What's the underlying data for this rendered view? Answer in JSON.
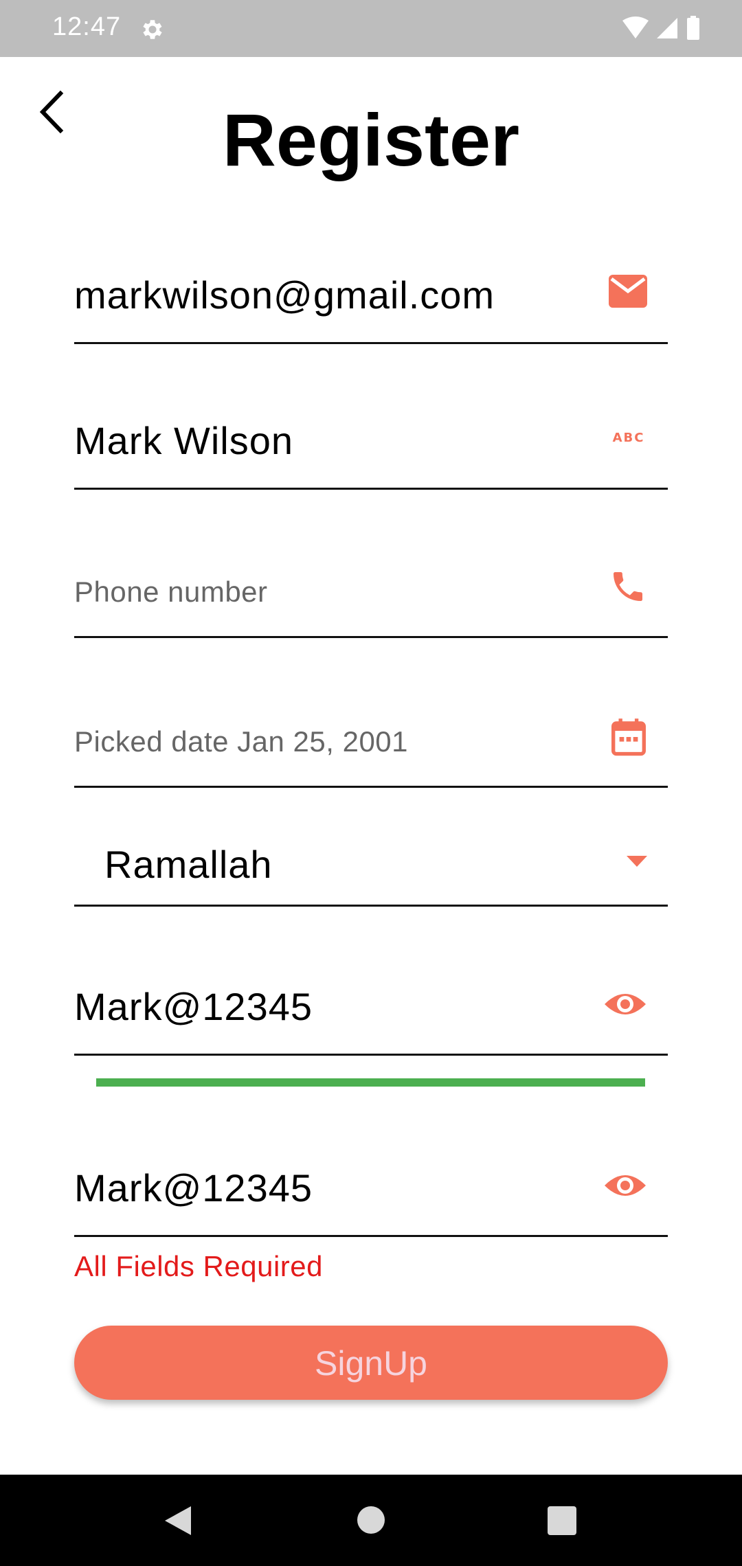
{
  "status_bar": {
    "time": "12:47"
  },
  "header": {
    "title": "Register"
  },
  "form": {
    "email": {
      "value": "markwilson@gmail.com"
    },
    "name": {
      "value": "Mark Wilson"
    },
    "phone": {
      "placeholder": "Phone number"
    },
    "date": {
      "label": "Picked date Jan 25, 2001"
    },
    "city": {
      "value": "Ramallah"
    },
    "password": {
      "value": "Mark@12345"
    },
    "confirm_password": {
      "value": "Mark@12345"
    },
    "password_strength": 1.0,
    "error": "All Fields Required",
    "signup_label": "SignUp"
  },
  "colors": {
    "accent": "#f4725a",
    "strength": "#4caf50",
    "error": "#e31b1b",
    "status_bar": "#bdbdbd"
  },
  "icons": {
    "email": "mail-icon",
    "name": "abc-icon",
    "phone": "phone-icon",
    "date": "calendar-icon",
    "city": "dropdown-arrow-icon",
    "password": "eye-icon",
    "confirm_password": "eye-icon"
  }
}
